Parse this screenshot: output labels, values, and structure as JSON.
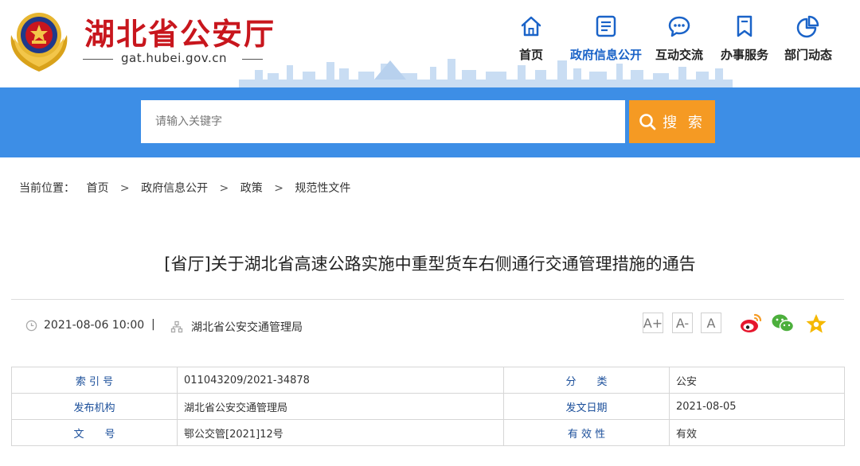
{
  "header": {
    "site_title": "湖北省公安厅",
    "site_domain": "gat.hubei.gov.cn",
    "colors": {
      "brand_red": "#c8161d",
      "nav_blue": "#1a63c8",
      "banner_blue": "#3d8ee6",
      "search_orange": "#f59a23"
    },
    "nav": [
      {
        "label": "首页",
        "icon": "home-icon"
      },
      {
        "label": "政府信息公开",
        "icon": "document-list-icon",
        "active": true
      },
      {
        "label": "互动交流",
        "icon": "chat-bubble-icon"
      },
      {
        "label": "办事服务",
        "icon": "bookmark-icon"
      },
      {
        "label": "部门动态",
        "icon": "pie-chart-icon"
      }
    ]
  },
  "search": {
    "placeholder": "请输入关键字",
    "button_label": "搜 索",
    "icon": "search-icon"
  },
  "breadcrumb": {
    "prefix": "当前位置：",
    "separator": ">",
    "items": [
      "首页",
      "政府信息公开",
      "政策",
      "规范性文件"
    ]
  },
  "article": {
    "title": "[省厅]关于湖北省高速公路实施中重型货车右侧通行交通管理措施的通告",
    "datetime": "2021-08-06 10:00",
    "divider": "|",
    "source": "湖北省公安交通管理局",
    "font_controls": [
      "A+",
      "A-",
      "A"
    ],
    "share_icons": [
      "weibo-icon",
      "wechat-icon",
      "favorite-star-icon"
    ]
  },
  "info_table": {
    "rows": [
      {
        "k1": "索 引 号",
        "v1": "011043209/2021-34878",
        "k2": "分　　类",
        "v2": "公安"
      },
      {
        "k1": "发布机构",
        "v1": "湖北省公安交通管理局",
        "k2": "发文日期",
        "v2": "2021-08-05"
      },
      {
        "k1": "文　　号",
        "v1": "鄂公交管[2021]12号",
        "k2": "有 效 性",
        "v2": "有效"
      }
    ]
  }
}
